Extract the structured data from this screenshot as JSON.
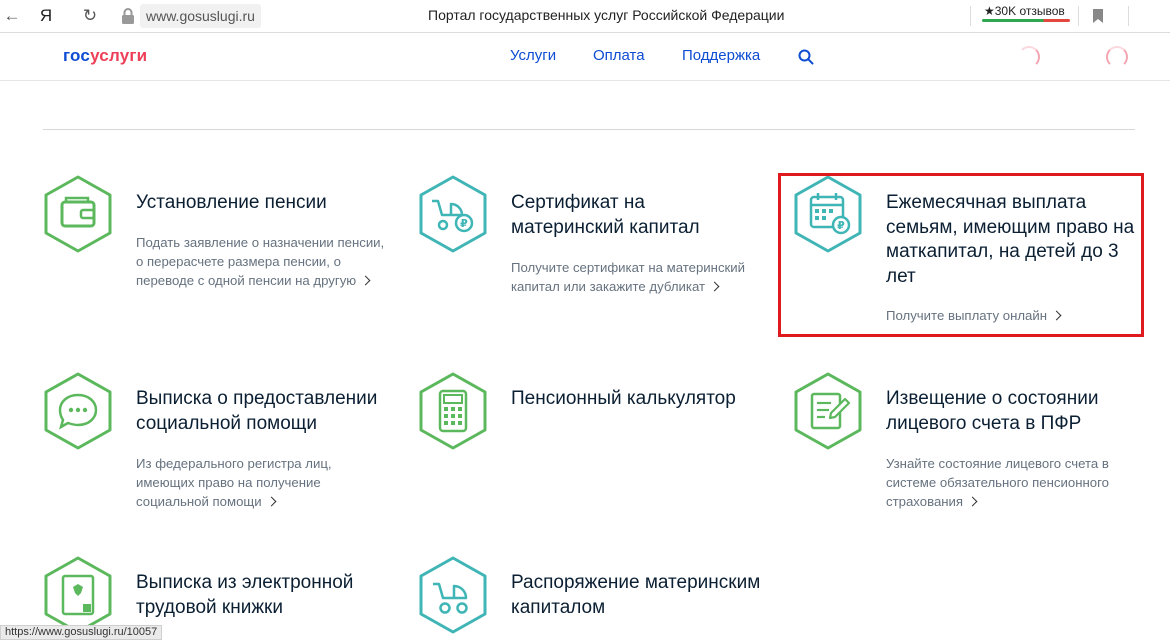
{
  "browser": {
    "back_icon": "←",
    "yandex_icon": "Я",
    "reload_icon": "↻",
    "address": "www.gosuslugi.ru",
    "tab_title": "Портал государственных услуг Российской Федерации",
    "reviews": "★30K отзывов"
  },
  "header": {
    "logo_part1": "гос",
    "logo_part2": "услуги",
    "nav": [
      "Услуги",
      "Оплата",
      "Поддержка"
    ]
  },
  "cards": [
    {
      "title": "Установление пенсии",
      "desc": "Подать заявление о назначении пенсии, о перерасчете размера пенсии, о переводе с одной пенсии на другую",
      "icon": "wallet-icon",
      "color": "#5cb85c"
    },
    {
      "title": "Сертификат на материнский капитал",
      "desc": "Получите сертификат на материнский капитал или закажите дубликат",
      "icon": "stroller-ruble-icon",
      "color": "#3fb5b5"
    },
    {
      "title": "Ежемесячная выплата семьям, имеющим право на маткапитал, на детей до 3 лет",
      "desc": "Получите выплату онлайн",
      "icon": "calendar-ruble-icon",
      "color": "#3fb5b5"
    },
    {
      "title": "Выписка о предоставлении социальной помощи",
      "desc": "Из федерального регистра лиц, имеющих право на получение социальной помощи",
      "icon": "chat-bubble-icon",
      "color": "#5cb85c"
    },
    {
      "title": "Пенсионный калькулятор",
      "desc": "",
      "icon": "calculator-icon",
      "color": "#5cb85c"
    },
    {
      "title": "Извещение о состоянии лицевого счета в ПФР",
      "desc": "Узнайте состояние лицевого счета в системе обязательного пенсионного страхования",
      "icon": "document-edit-icon",
      "color": "#5cb85c"
    },
    {
      "title": "Выписка из электронной трудовой книжки",
      "desc": "",
      "icon": "employment-record-icon",
      "color": "#5cb85c"
    },
    {
      "title": "Распоряжение материнским капиталом",
      "desc": "",
      "icon": "stroller-icon",
      "color": "#3fb5b5"
    }
  ],
  "status_url": "https://www.gosuslugi.ru/10057"
}
